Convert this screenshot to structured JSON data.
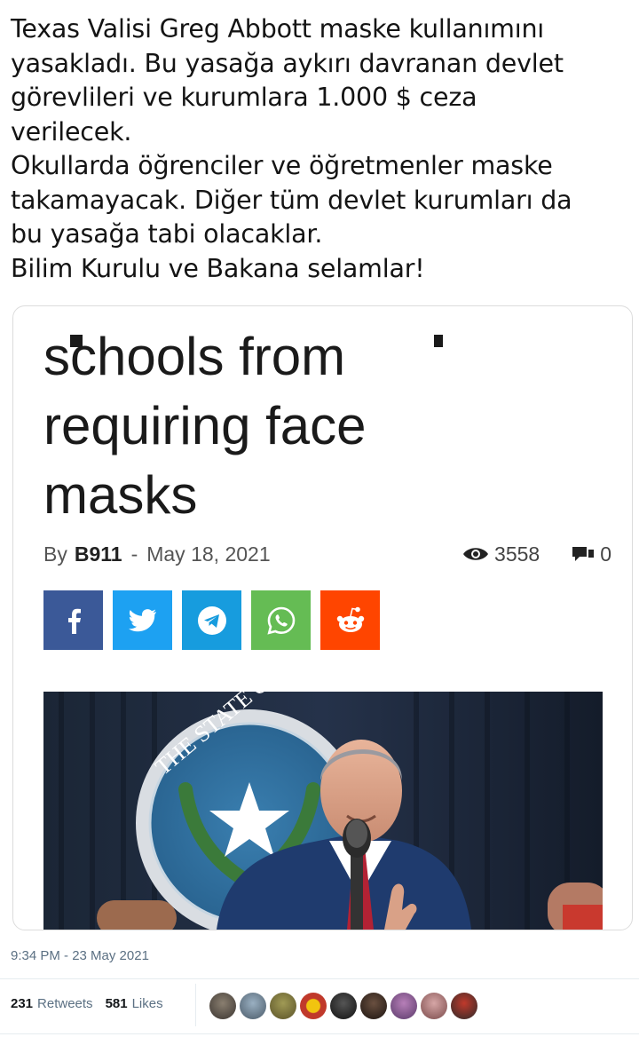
{
  "tweet": {
    "lines": [
      "Texas Valisi Greg Abbott maske kullanımını",
      "yasakladı. Bu yasağa aykırı davranan devlet",
      "görevlileri ve kurumlara 1.000 $ ceza",
      "verilecek.",
      "Okullarda öğrenciler ve öğretmenler maske",
      "takamayacak. Diğer tüm devlet kurumları da",
      "bu yasağa tabi olacaklar.",
      "Bilim Kurulu ve Bakana selamlar!"
    ],
    "timestamp": "9:34 PM - 23 May 2021",
    "retweets_count": "231",
    "retweets_label": "Retweets",
    "likes_count": "581",
    "likes_label": "Likes"
  },
  "article": {
    "headline_lines": [
      "schools from",
      "requiring face",
      "masks"
    ],
    "by_label": "By",
    "author": "B911",
    "separator": "-",
    "date": "May 18, 2021",
    "views": "3558",
    "comments": "0"
  },
  "share_buttons": [
    {
      "name": "facebook",
      "icon": "facebook-icon",
      "color": "#3b5998"
    },
    {
      "name": "twitter",
      "icon": "twitter-icon",
      "color": "#1da1f2"
    },
    {
      "name": "telegram",
      "icon": "telegram-icon",
      "color": "#179cde"
    },
    {
      "name": "whatsapp",
      "icon": "whatsapp-icon",
      "color": "#65bc54"
    },
    {
      "name": "reddit",
      "icon": "reddit-icon",
      "color": "#ff4500"
    }
  ],
  "photo": {
    "subject": "man-speaking-at-podium",
    "seal_text": "THE STATE OF TEXAS GOV"
  },
  "liker_avatars": [
    "avatar-1",
    "avatar-2",
    "avatar-3",
    "avatar-4",
    "avatar-5",
    "avatar-6",
    "avatar-7",
    "avatar-8",
    "avatar-9"
  ]
}
